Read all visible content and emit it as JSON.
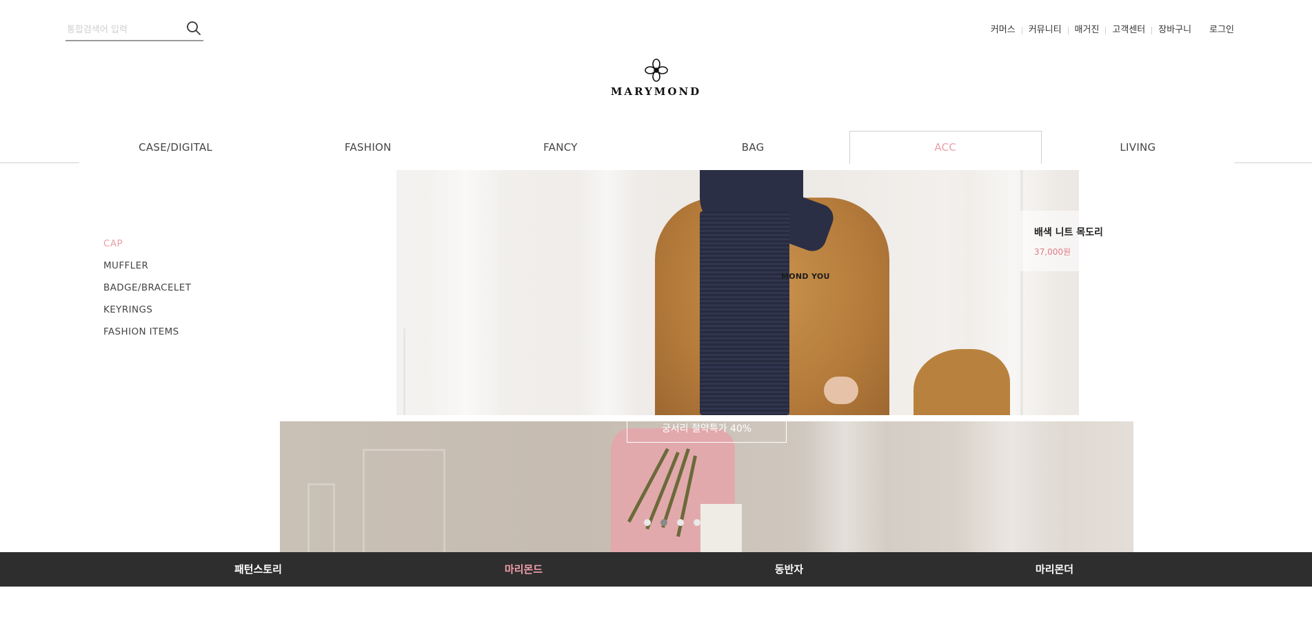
{
  "search": {
    "placeholder": "통합검색어 입력",
    "icon": "search-icon"
  },
  "util_nav": [
    "커머스",
    "커뮤니티",
    "매거진",
    "고객센터",
    "장바구니",
    "로그인"
  ],
  "logo": {
    "wordmark": "MARYMOND",
    "icon": "flower-logo-icon"
  },
  "main_nav": {
    "items": [
      "CASE/DIGITAL",
      "FASHION",
      "FANCY",
      "BAG",
      "ACC",
      "LIVING"
    ],
    "active": "ACC",
    "active_color": "#e8a0a8"
  },
  "side_menu": {
    "items": [
      "CAP",
      "MUFFLER",
      "BADGE/BRACELET",
      "KEYRINGS",
      "FASHION ITEMS"
    ],
    "active": "CAP"
  },
  "banner": {
    "sweater_text": "MOND YOU",
    "product_name": "배색 니트 목도리",
    "product_price": "37,000원",
    "price_color": "#e07a82"
  },
  "banner2": {
    "tag": "궁서리 절약특가 40%",
    "dots": 4,
    "active_dot": 2
  },
  "footer_nav": {
    "items": [
      "패턴스토리",
      "마리몬드",
      "동반자",
      "마리몬더"
    ],
    "active": "마리몬드",
    "bar_color": "#2e2e2e",
    "active_color": "#f0a0aa"
  }
}
